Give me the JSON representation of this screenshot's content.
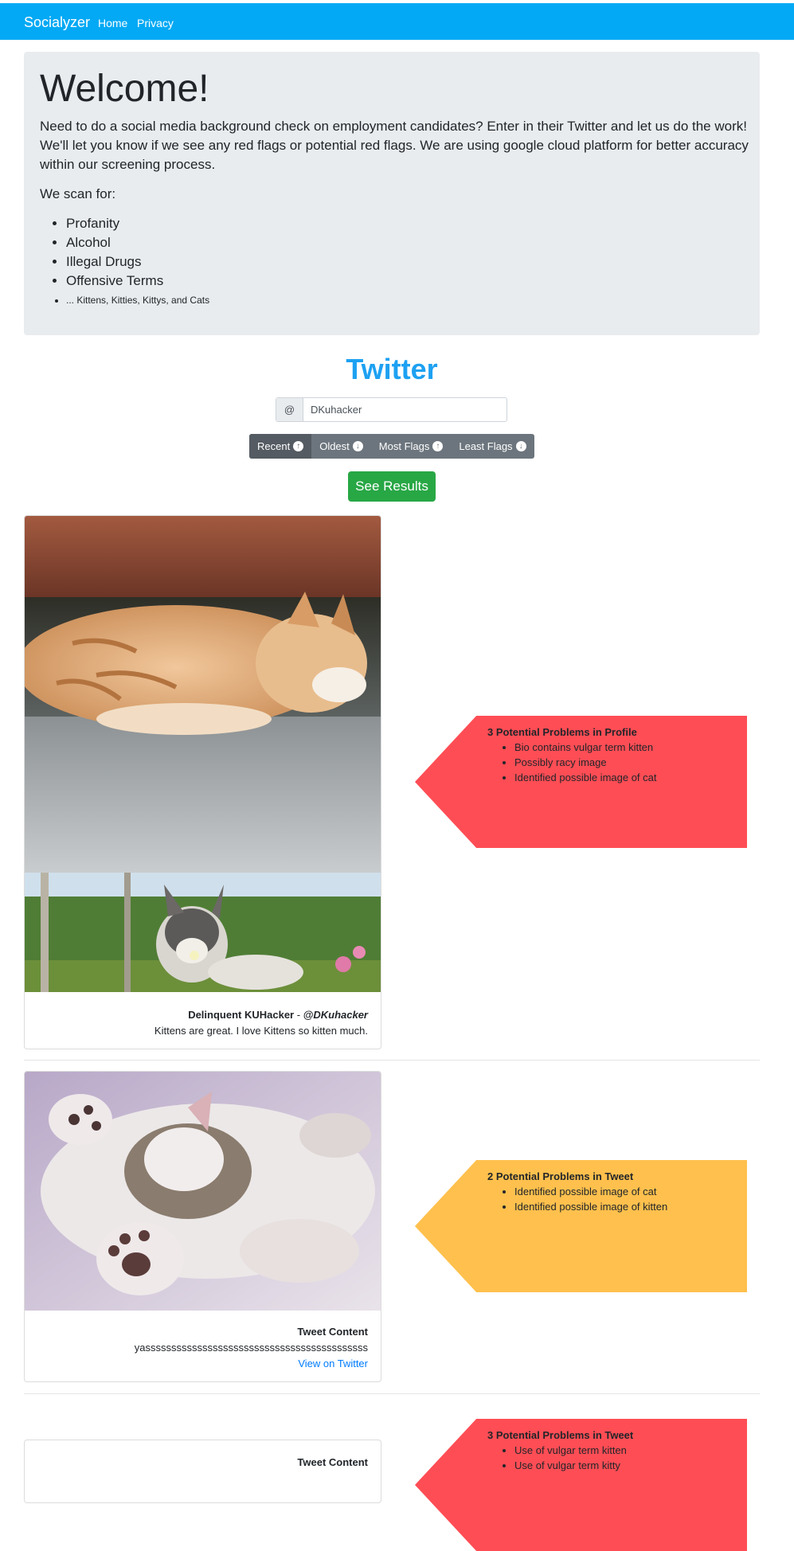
{
  "navbar": {
    "brand": "Socialyzer",
    "links": [
      "Home",
      "Privacy"
    ]
  },
  "jumbotron": {
    "title": "Welcome!",
    "lead": "Need to do a social media background check on employment candidates? Enter in their Twitter and let us do the work! We'll let you know if we see any red flags or potential red flags. We are using google cloud platform for better accuracy within our screening process.",
    "scan_label": "We scan for:",
    "scan_items": [
      "Profanity",
      "Alcohol",
      "Illegal Drugs",
      "Offensive Terms",
      "... Kittens, Kitties, Kittys, and Cats"
    ]
  },
  "twitter": {
    "heading": "Twitter",
    "input_prefix": "@",
    "handle": "DKuhacker",
    "sort_buttons": [
      {
        "label": "Recent",
        "icon": "arrow-up-circle-icon",
        "active": true
      },
      {
        "label": "Oldest",
        "icon": "arrow-down-circle-icon",
        "active": false
      },
      {
        "label": "Most Flags",
        "icon": "arrow-up-circle-icon",
        "active": false
      },
      {
        "label": "Least Flags",
        "icon": "arrow-down-circle-icon",
        "active": false
      }
    ],
    "see_results": "See Results"
  },
  "results": [
    {
      "images": [
        "sleeping-orange-kitten-photo",
        "kitten-smelling-flower-photo"
      ],
      "title_name": "Delinquent KUHacker",
      "title_sep": " - ",
      "title_handle": "@DKuhacker",
      "text": "Kittens are great. I love Kittens so kitten much.",
      "flag_title": "3 Potential Problems in Profile",
      "flags": [
        "Bio contains vulgar term kitten",
        "Possibly racy image",
        "Identified possible image of cat"
      ],
      "severity_color": "#ff4d55"
    },
    {
      "images": [
        "kitten-paws-photo"
      ],
      "title": "Tweet Content",
      "text": "yasssssssssssssssssssssssssssssssssssssssssss",
      "link": "View on Twitter",
      "flag_title": "2 Potential Problems in Tweet",
      "flags": [
        "Identified possible image of cat",
        "Identified possible image of kitten"
      ],
      "severity_color": "#ffc04d"
    },
    {
      "title": "Tweet Content",
      "flag_title": "3 Potential Problems in Tweet",
      "flags": [
        "Use of vulgar term kitten",
        "Use of vulgar term kitty"
      ],
      "severity_color": "#ff4d55"
    }
  ]
}
